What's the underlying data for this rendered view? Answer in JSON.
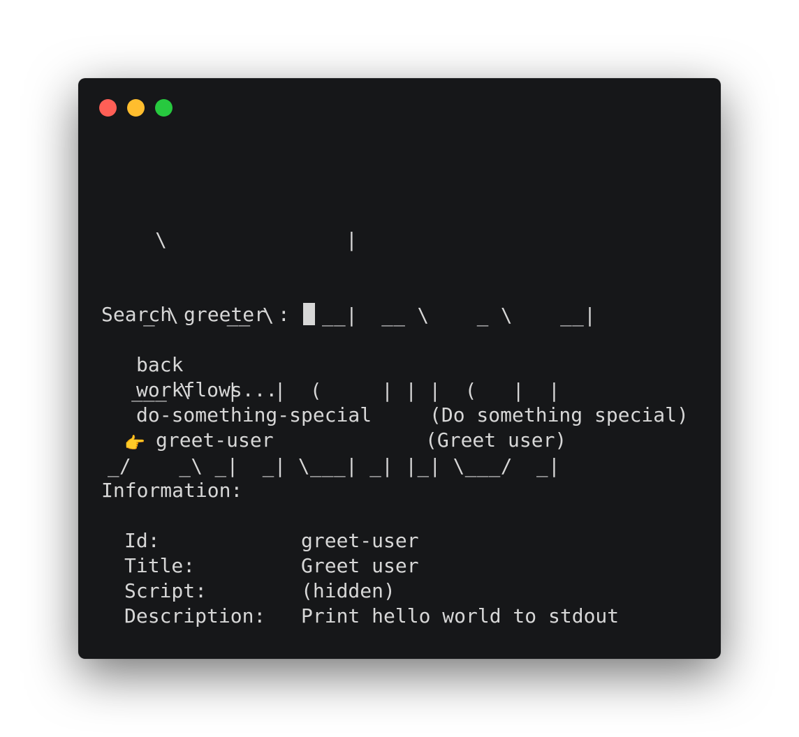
{
  "window": {
    "traffic_lights": {
      "close_color": "#ff5f56",
      "minimize_color": "#ffbd2e",
      "zoom_color": "#27c93f"
    }
  },
  "banner": {
    "lines": [
      "    \\               |",
      "   _ \\    __ \\    __|  __ \\    _ \\    __|",
      "  ___ \\   |   |  (     | | |  (   |  |",
      "_/    _\\ _|  _| \\___| _| |_| \\___/  _|"
    ]
  },
  "prompt": {
    "label": "Search greeter : "
  },
  "menu": {
    "items": [
      {
        "label": "back",
        "description": ""
      },
      {
        "label": "workflows...",
        "description": ""
      },
      {
        "label": "do-something-special",
        "description": "(Do something special)"
      },
      {
        "label": "greet-user",
        "description": "(Greet user)"
      }
    ],
    "selected_index": 3,
    "pointer_icon": "👉"
  },
  "info": {
    "heading": "Information:",
    "rows": [
      {
        "key": "Id:",
        "value": "greet-user"
      },
      {
        "key": "Title:",
        "value": "Greet user"
      },
      {
        "key": "Script:",
        "value": "(hidden)"
      },
      {
        "key": "Description:",
        "value": "Print hello world to stdout"
      }
    ]
  }
}
